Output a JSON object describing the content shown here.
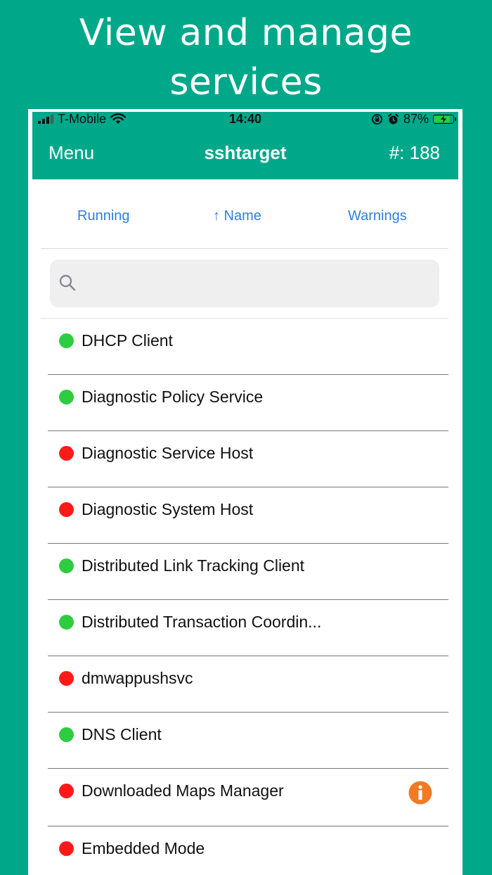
{
  "promo": {
    "title_line1": "View and manage",
    "title_line2": "services"
  },
  "status_bar": {
    "carrier": "T-Mobile",
    "time": "14:40",
    "battery_text": "87%",
    "battery_level": 0.87
  },
  "nav": {
    "menu_label": "Menu",
    "title": "sshtarget",
    "count_label": "#: 188"
  },
  "sort": {
    "running_label": "Running",
    "name_label": "↑ Name",
    "warnings_label": "Warnings"
  },
  "search": {
    "placeholder": ""
  },
  "colors": {
    "brand": "#00A88A",
    "running": "#2ECC40",
    "stopped": "#FF1A1A",
    "warning": "#F27A24",
    "link": "#2F7FD9"
  },
  "services": [
    {
      "name": "DHCP Client",
      "status": "running",
      "warning": false
    },
    {
      "name": "Diagnostic Policy Service",
      "status": "running",
      "warning": false
    },
    {
      "name": "Diagnostic Service Host",
      "status": "stopped",
      "warning": false
    },
    {
      "name": "Diagnostic System Host",
      "status": "stopped",
      "warning": false
    },
    {
      "name": "Distributed Link Tracking Client",
      "status": "running",
      "warning": false
    },
    {
      "name": "Distributed Transaction Coordin...",
      "status": "running",
      "warning": false
    },
    {
      "name": "dmwappushsvc",
      "status": "stopped",
      "warning": false
    },
    {
      "name": "DNS Client",
      "status": "running",
      "warning": false
    },
    {
      "name": "Downloaded Maps Manager",
      "status": "stopped",
      "warning": true
    },
    {
      "name": "Embedded Mode",
      "status": "stopped",
      "warning": false
    }
  ]
}
